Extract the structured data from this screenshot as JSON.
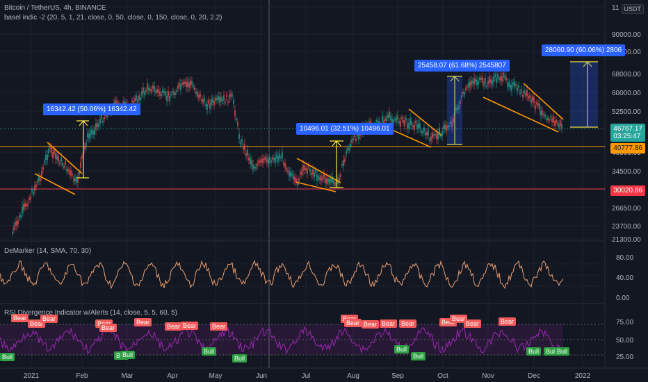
{
  "header": {
    "symbol": "Bitcoin / TetherUS, 4h, BINANCE",
    "indicator": "basel indic -2 (20, 5, 1, 21, close, 0, 50, close, 0, 150, close, 0, 20, 2.2)"
  },
  "currency_badge": "USDT",
  "price_axis": {
    "ticks": [
      "11",
      "90000.00",
      "80000.00",
      "68000.00",
      "60000.00",
      "52500.00",
      "46500.00",
      "40500.00",
      "34500.00",
      "30000.00",
      "26650.00",
      "23700.00",
      "21300.00"
    ]
  },
  "price_tags": {
    "current_price": "46767.17",
    "countdown": "03:25:47",
    "support_level": "40777.86",
    "lower_level": "30020.86"
  },
  "measurements": [
    {
      "label": "16342.42 (50.06%) 16342.42"
    },
    {
      "label": "10496.01 (32.51%) 10496.01"
    },
    {
      "label": "25458.07 (61.68%) 2545807"
    },
    {
      "label": "28060.90 (60.06%) 2806"
    }
  ],
  "demarker": {
    "label": "DeMarker (14, SMA, 70, 30)",
    "ticks": [
      "80.00",
      "40.00",
      "0.00"
    ]
  },
  "rsi": {
    "label": "RSI Divergence Indicator w/Alerts (14, close, 5, 5, 60, 5)",
    "ticks": [
      "75.00",
      "50.00",
      "25.00"
    ],
    "bear_label": "Bear",
    "bull_label": "Bull"
  },
  "time_axis": [
    "2021",
    "Feb",
    "Mar",
    "Apr",
    "May",
    "Jun",
    "Jul",
    "Aug",
    "Sep",
    "Oct",
    "Nov",
    "Dec",
    "2022"
  ],
  "colors": {
    "up": "#26a69a",
    "down": "#ef5350",
    "support": "#ff9800",
    "resistance": "#f23645",
    "measure": "#2962ff",
    "rsi": "#9c27b0"
  }
}
